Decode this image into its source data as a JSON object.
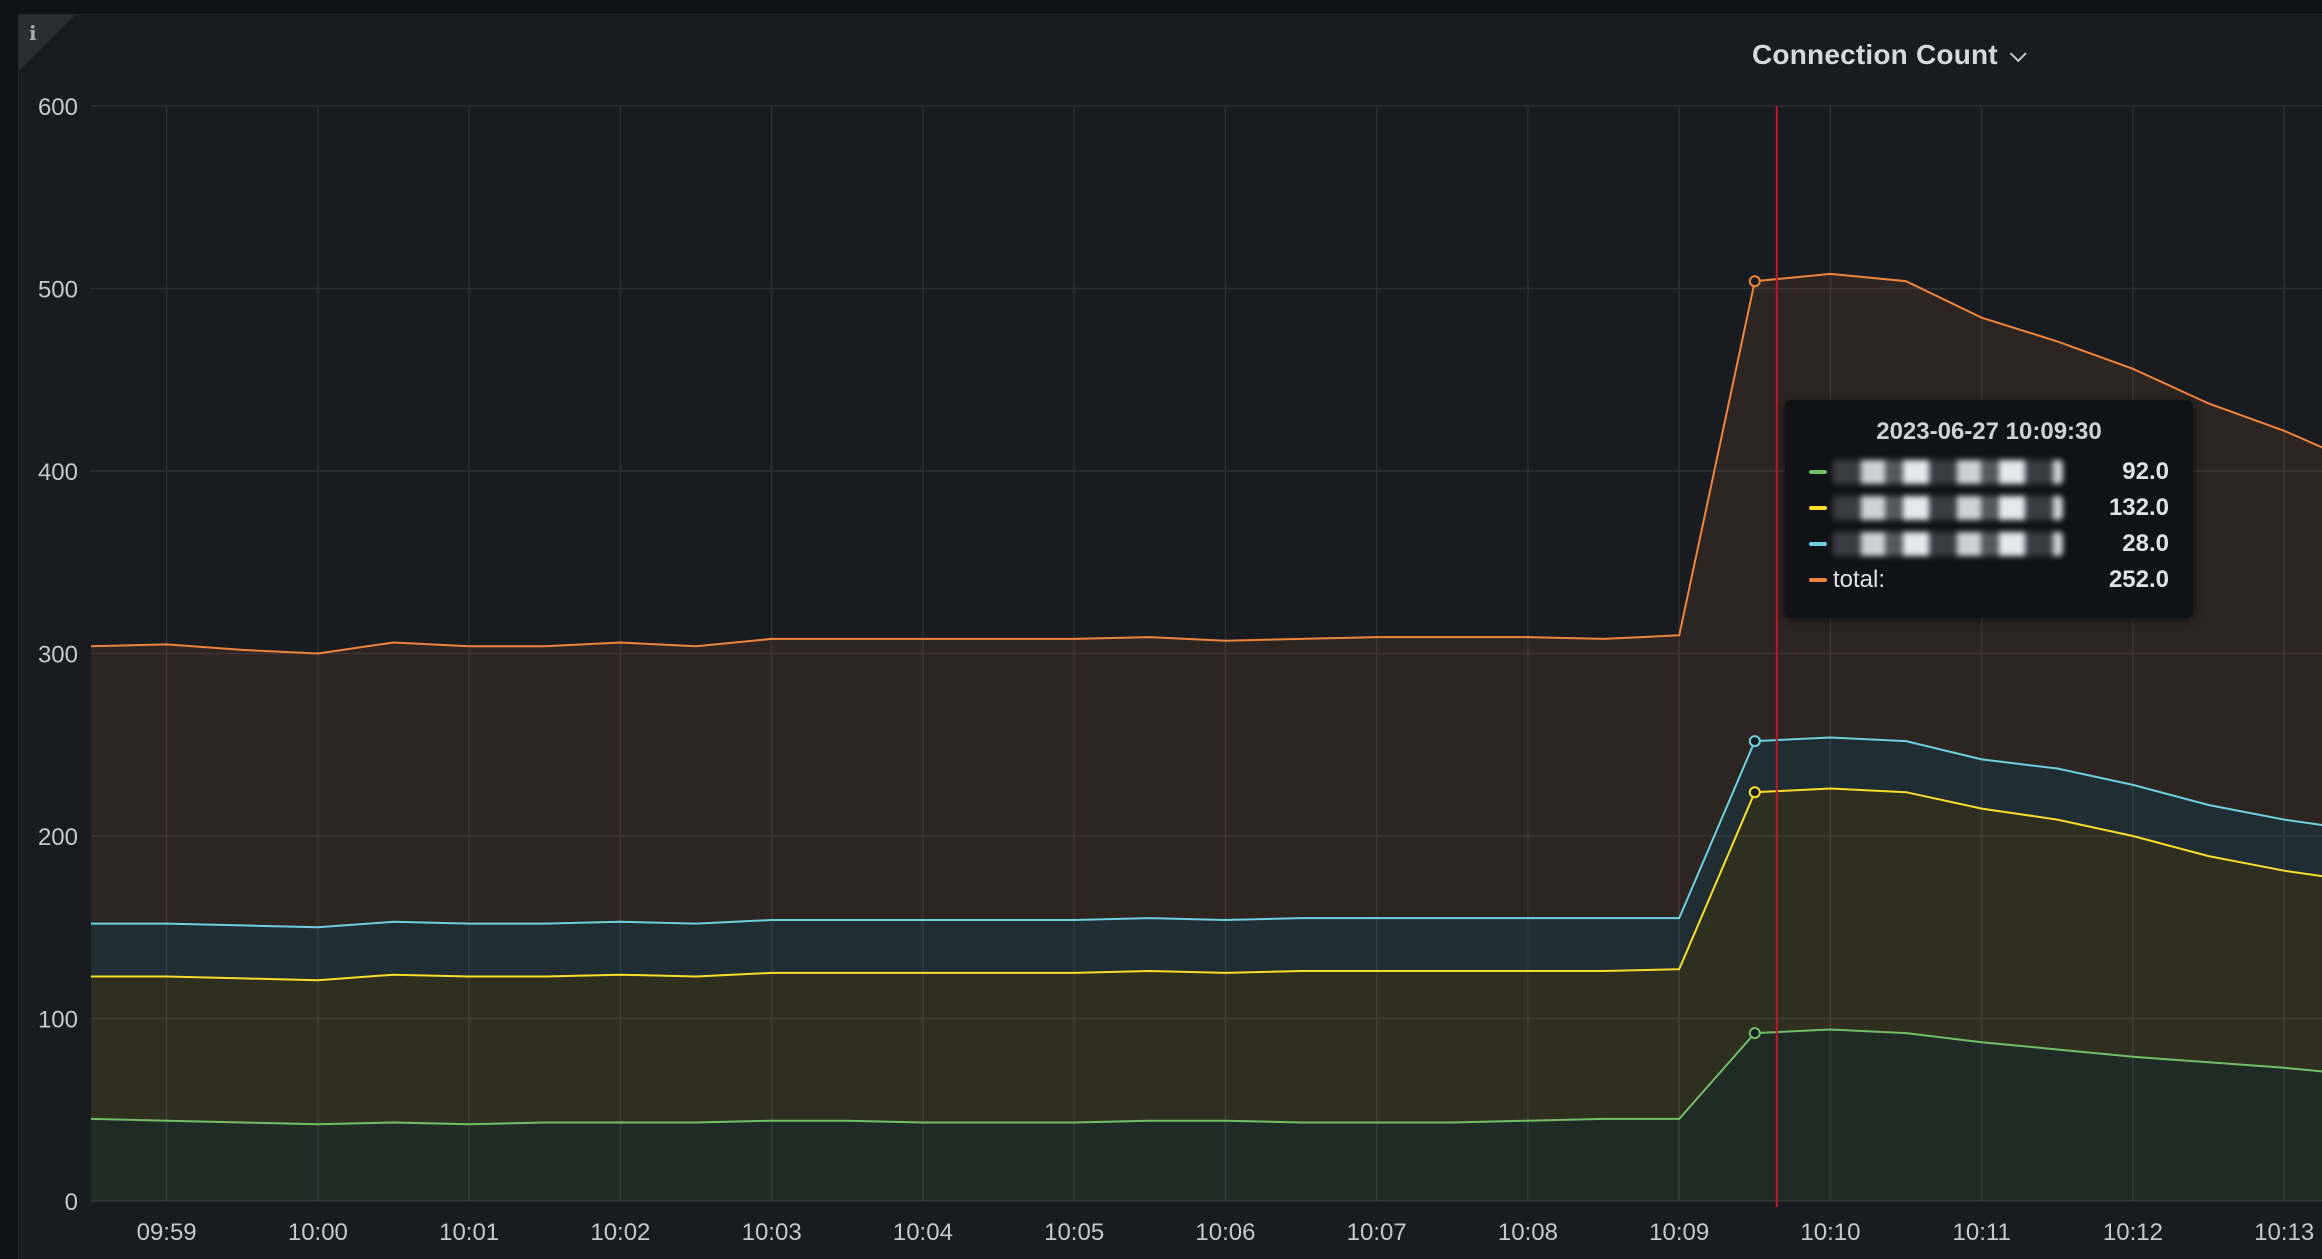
{
  "panel": {
    "title": "Connection Count",
    "info_icon": "info-icon",
    "title_icon": "chevron-down-icon"
  },
  "colors": {
    "green": "#73bf69",
    "yellow": "#fade2a",
    "blue": "#6ed0e0",
    "orange": "#ef843c",
    "cursor": "#c4162a",
    "grid": "#2c2f35",
    "axis_text": "#c7c8ca"
  },
  "chart_data": {
    "type": "area",
    "stacked": true,
    "x": [
      "09:58:30",
      "09:59:00",
      "09:59:30",
      "10:00:00",
      "10:00:30",
      "10:01:00",
      "10:01:30",
      "10:02:00",
      "10:02:30",
      "10:03:00",
      "10:03:30",
      "10:04:00",
      "10:04:30",
      "10:05:00",
      "10:05:30",
      "10:06:00",
      "10:06:30",
      "10:07:00",
      "10:07:30",
      "10:08:00",
      "10:08:30",
      "10:09:00",
      "10:09:30",
      "10:10:00",
      "10:10:30",
      "10:11:00",
      "10:11:30",
      "10:12:00",
      "10:12:30",
      "10:13:00",
      "10:13:15"
    ],
    "x_ticks": [
      "09:59",
      "10:00",
      "10:01",
      "10:02",
      "10:03",
      "10:04",
      "10:05",
      "10:06",
      "10:07",
      "10:08",
      "10:09",
      "10:10",
      "10:11",
      "10:12",
      "10:13"
    ],
    "y_ticks": [
      0,
      100,
      200,
      300,
      400,
      500,
      600
    ],
    "ylim": [
      0,
      600
    ],
    "grid": true,
    "series": [
      {
        "color_key": "green",
        "values": [
          45,
          44,
          43,
          42,
          43,
          42,
          43,
          43,
          43,
          44,
          44,
          43,
          43,
          43,
          44,
          44,
          43,
          43,
          43,
          44,
          45,
          45,
          92,
          94,
          92,
          87,
          83,
          79,
          76,
          73,
          71
        ]
      },
      {
        "color_key": "yellow",
        "values": [
          78,
          79,
          79,
          79,
          81,
          81,
          80,
          81,
          80,
          81,
          81,
          82,
          82,
          82,
          82,
          81,
          83,
          83,
          83,
          82,
          81,
          82,
          132,
          132,
          132,
          128,
          126,
          121,
          113,
          108,
          107
        ]
      },
      {
        "color_key": "blue",
        "values": [
          29,
          29,
          29,
          29,
          29,
          29,
          29,
          29,
          29,
          29,
          29,
          29,
          29,
          29,
          29,
          29,
          29,
          29,
          29,
          29,
          29,
          28,
          28,
          28,
          28,
          27,
          28,
          28,
          28,
          28,
          28
        ]
      },
      {
        "name": "total",
        "color_key": "orange",
        "values": [
          152,
          153,
          151,
          150,
          153,
          152,
          152,
          153,
          152,
          154,
          154,
          154,
          154,
          154,
          154,
          153,
          153,
          154,
          154,
          154,
          153,
          155,
          252,
          254,
          252,
          242,
          234,
          228,
          220,
          213,
          207
        ]
      }
    ],
    "cursor_x": "10:09:30",
    "tooltip": {
      "time": "2023-06-27 10:09:30",
      "rows": [
        {
          "color_key": "green",
          "value": "92.0"
        },
        {
          "color_key": "yellow",
          "value": "132.0"
        },
        {
          "color_key": "blue",
          "value": "28.0"
        },
        {
          "label": "total:",
          "color_key": "orange",
          "value": "252.0"
        }
      ]
    }
  }
}
